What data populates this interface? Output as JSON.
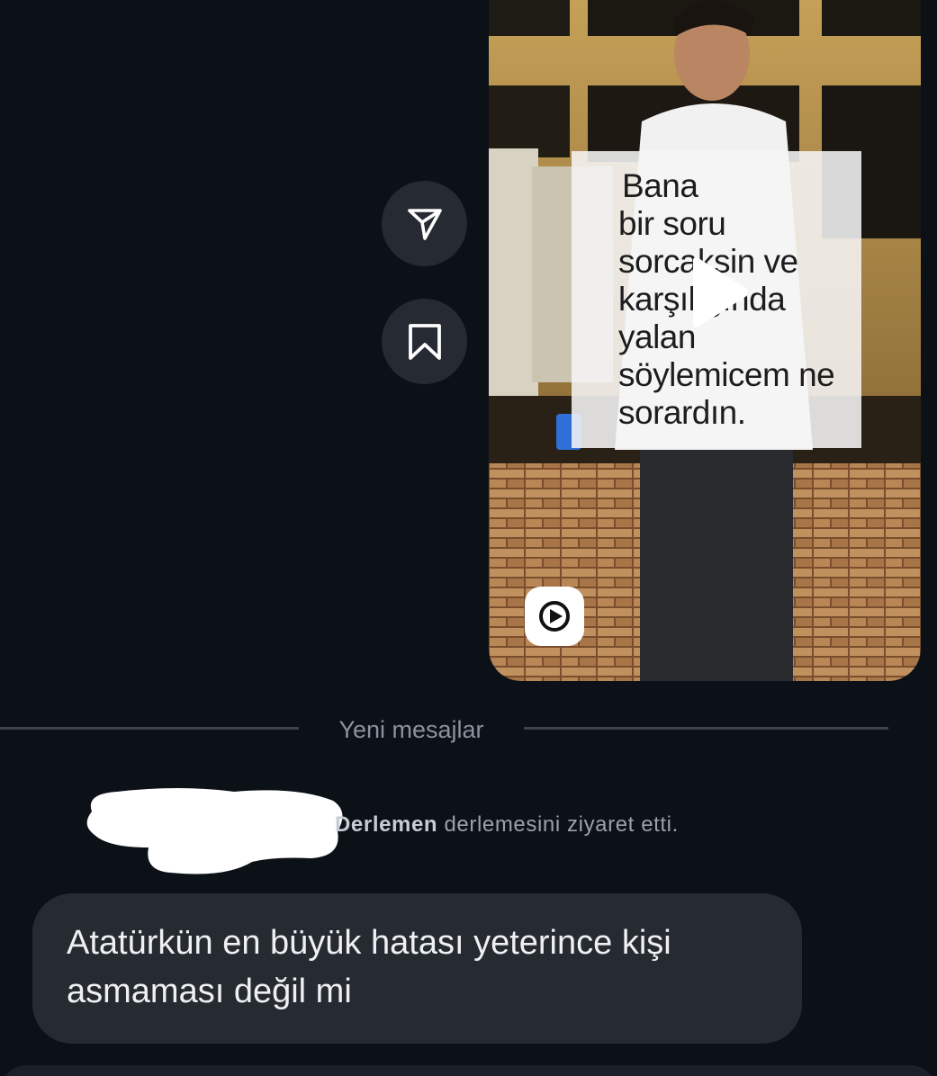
{
  "actions": {
    "share_icon": "send-icon",
    "save_icon": "bookmark-icon"
  },
  "video": {
    "caption_lines": [
      "Bana",
      "bir soru",
      "sorcaksin  ve",
      "karşılığında",
      "yalan",
      "söylemicem ne",
      "sorardın."
    ],
    "play_icon": "play-icon",
    "reel_icon": "reel-icon"
  },
  "divider": {
    "label": "Yeni mesajlar"
  },
  "event": {
    "name_partial": "Derlemen",
    "suffix": " derlemesini ziyaret etti."
  },
  "message": {
    "lines": [
      "Atatürkün en büyük hatası yeterince kişi",
      "asmaması değil mi"
    ]
  },
  "colors": {
    "background": "#0c1017",
    "bubble": "#262a31",
    "button": "#262b33",
    "divider": "#3c434d"
  }
}
